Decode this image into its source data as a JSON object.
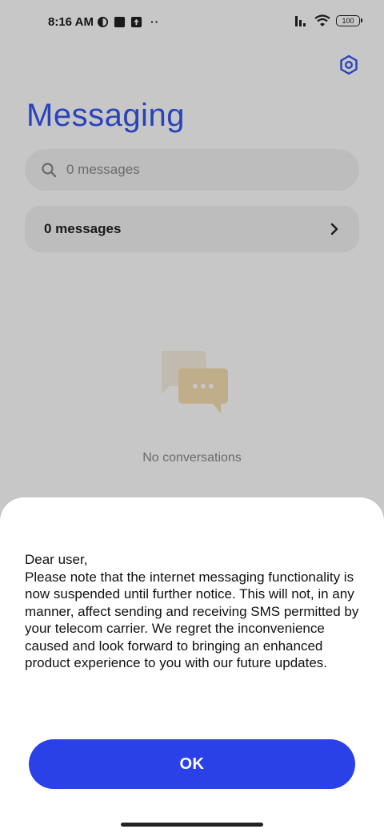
{
  "status_bar": {
    "time": "8:16 AM",
    "battery": "100",
    "dots": "··",
    "icons": [
      "vpn-key-icon",
      "square-notification-icon",
      "upload-notification-icon",
      "signal-icon",
      "wifi-icon",
      "battery-icon"
    ]
  },
  "header": {
    "title": "Messaging",
    "settings_icon": "gear-hexagon-icon"
  },
  "search": {
    "placeholder": "0 messages",
    "icon": "search-icon"
  },
  "messages_row": {
    "label": "0 messages",
    "icon": "chevron-right-icon"
  },
  "empty_state": {
    "text": "No conversations",
    "icon": "chat-bubbles-icon"
  },
  "dialog": {
    "message": "Dear user,\nPlease note that the internet messaging functionality is now suspended until further notice. This will not, in any manner, affect sending and receiving SMS permitted by your telecom carrier. We regret the inconvenience caused and look forward to bringing an enhanced product experience to you with our future updates.",
    "ok_label": "OK"
  },
  "colors": {
    "accent": "#3557f0",
    "button": "#2a41e8",
    "scrim": "rgba(0,0,0,0.22)"
  }
}
